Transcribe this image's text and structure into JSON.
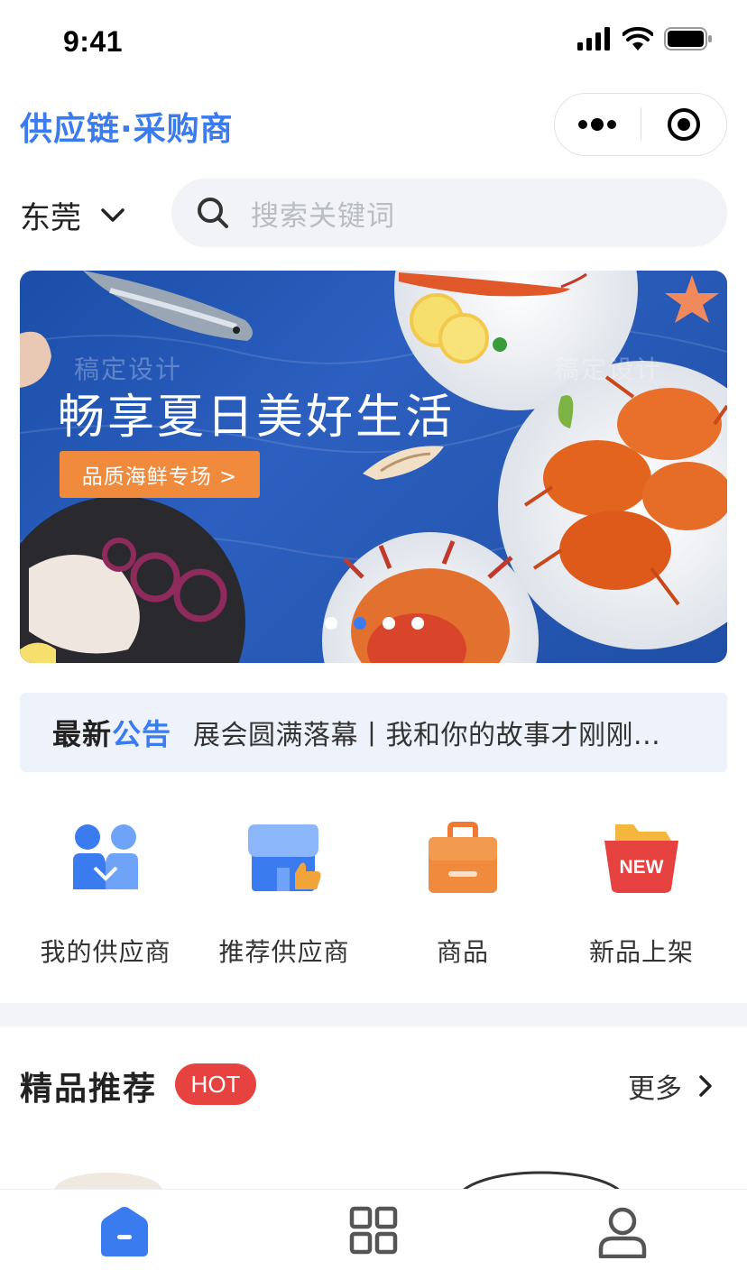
{
  "status": {
    "time": "9:41"
  },
  "header": {
    "title": "供应链·采购商"
  },
  "location": {
    "city": "东莞"
  },
  "search": {
    "placeholder": "搜索关键词"
  },
  "banner": {
    "title": "畅享夏日美好生活",
    "button": "品质海鲜专场 >",
    "watermark": "稿定设计",
    "dots": 4,
    "active_dot": 1
  },
  "notice": {
    "tag_part1": "最新",
    "tag_part2": "公告",
    "text": "展会圆满落幕丨我和你的故事才刚刚..."
  },
  "grid": [
    {
      "label": "我的供应商",
      "icon": "suppliers-people-icon"
    },
    {
      "label": "推荐供应商",
      "icon": "recommend-store-icon"
    },
    {
      "label": "商品",
      "icon": "product-bag-icon"
    },
    {
      "label": "新品上架",
      "icon": "new-arrival-icon",
      "badge": "NEW"
    }
  ],
  "section": {
    "title": "精品推荐",
    "badge": "HOT",
    "more": "更多"
  },
  "colors": {
    "brand": "#3b7bf0",
    "orange": "#f08a3c",
    "hot": "#e64340"
  }
}
